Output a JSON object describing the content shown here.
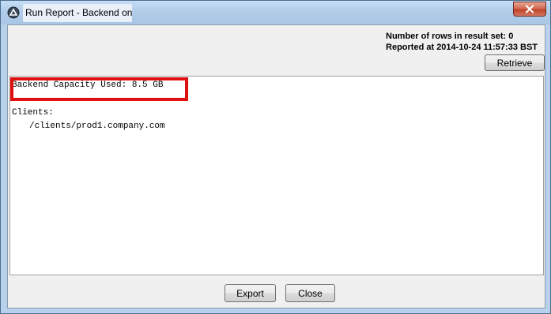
{
  "window": {
    "title": "Run Report - Backend on",
    "icon": "app-logo-icon",
    "close_icon": "close-icon"
  },
  "info": {
    "rows_label": "Number of rows in result set: 0",
    "reported_label": "Reported at 2014-10-24 11:57:33 BST"
  },
  "toolbar": {
    "retrieve_label": "Retrieve"
  },
  "report": {
    "line1": "Backend Capacity Used: 8.5 GB",
    "line2": "Clients:",
    "line3": "/clients/prod1.company.com"
  },
  "footer": {
    "export_label": "Export",
    "close_label": "Close"
  },
  "colors": {
    "highlight": "#e01010",
    "titlebar": "#b9d1ea",
    "close_button": "#c0432a"
  }
}
